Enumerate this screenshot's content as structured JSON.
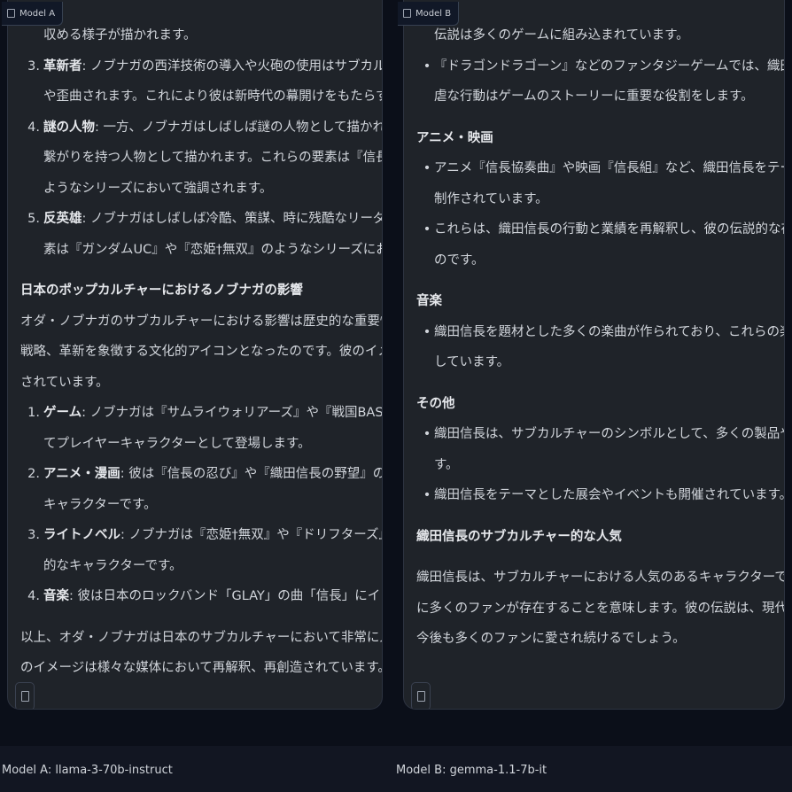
{
  "panel_a": {
    "tag": "Model A",
    "lines": [
      {
        "kind": "cont",
        "text": "収める様子が描かれます。"
      },
      {
        "kind": "num",
        "num": "3.",
        "bold": "革新者",
        "text": ": ノブナガの西洋技術の導入や火砲の使用はサブカルチャーにおいてしばしば誇張"
      },
      {
        "kind": "cont",
        "text": "や歪曲されます。これにより彼は新時代の幕開けをもたらすビジョナリーとして描かれます。"
      },
      {
        "kind": "num",
        "num": "4.",
        "bold": "謎の人物",
        "text": ": 一方、ノブナガはしばしば謎の人物として描かれ、超人的な能力や超自然的な"
      },
      {
        "kind": "cont",
        "text": "繋がりを持つ人物として描かれます。これらの要素は『信長THE FOOL』や『ドリフターズ』の"
      },
      {
        "kind": "cont",
        "text": "ようなシリーズにおいて強調されます。"
      },
      {
        "kind": "num",
        "num": "5.",
        "bold": "反英雄",
        "text": ": ノブナガはしばしば冷酷、策謀、時に残酷なリーダーとして描かれます。これらの要"
      },
      {
        "kind": "cont",
        "text": "素は『ガンダムUC』や『恋姫†無双』のようなシリーズにおいて強調されます。"
      },
      {
        "kind": "gap"
      },
      {
        "kind": "heading",
        "text": "日本のポップカルチャーにおけるノブナガの影響"
      },
      {
        "kind": "para",
        "text": "オダ・ノブナガのサブカルチャーにおける影響は歴史的な重要性を超えています。彼はパワー、"
      },
      {
        "kind": "para",
        "text": "戦略、革新を象徴する文化的アイコンとなったのです。彼のイメージは様々な媒体において使用"
      },
      {
        "kind": "para",
        "text": "されています。"
      },
      {
        "kind": "num",
        "num": "1.",
        "bold": "ゲーム",
        "text": ": ノブナガは『サムライウォリアーズ』や『戦国BASARA』のようなゲームシリーズにおい"
      },
      {
        "kind": "cont",
        "text": "てプレイヤーキャラクターとして登場します。"
      },
      {
        "kind": "num",
        "num": "2.",
        "bold": "アニメ・漫画",
        "text": ": 彼は『信長の忍び』や『織田信長の野望』のようなアニメシリーズの中心的な"
      },
      {
        "kind": "cont",
        "text": "キャラクターです。"
      },
      {
        "kind": "num",
        "num": "3.",
        "bold": "ライトノベル",
        "text": ": ノブナガは『恋姫†無双』や『ドリフターズ』のようなライトノベルシリーズの中心"
      },
      {
        "kind": "cont",
        "text": "的なキャラクターです。"
      },
      {
        "kind": "num",
        "num": "4.",
        "bold": "音楽",
        "text": ": 彼は日本のロックバンド「GLAY」の曲「信長」にインスパイアされています。"
      },
      {
        "kind": "gap"
      },
      {
        "kind": "para",
        "text": "以上、オダ・ノブナガは日本のサブカルチャーにおいて非常に人気のあるキャラクターであり、彼"
      },
      {
        "kind": "para",
        "text": "のイメージは様々な媒体において再解釈、再創造されています。"
      }
    ],
    "footer": "Model A: llama-3-70b-instruct"
  },
  "panel_b": {
    "tag": "Model B",
    "lines": [
      {
        "kind": "bulcont",
        "text": "伝説は多くのゲームに組み込まれています。"
      },
      {
        "kind": "bullet",
        "text": "『ドラゴンドラゴーン』などのファンタジーゲームでは、織田信長は悪役として出現し、彼の残"
      },
      {
        "kind": "bulcont",
        "text": "虐な行動はゲームのストーリーに重要な役割をします。"
      },
      {
        "kind": "gap"
      },
      {
        "kind": "heading",
        "text": "アニメ・映画"
      },
      {
        "kind": "bullet",
        "text": "アニメ『信長協奏曲』や映画『信長組』など、織田信長をテーマとした多くのアニメや映画が"
      },
      {
        "kind": "bulcont",
        "text": "制作されています。"
      },
      {
        "kind": "bullet",
        "text": "これらは、織田信長の行動と業績を再解釈し、彼の伝説的な存在を新しい世代に伝えるも"
      },
      {
        "kind": "bulcont",
        "text": "のです。"
      },
      {
        "kind": "gap"
      },
      {
        "kind": "heading",
        "text": "音楽"
      },
      {
        "kind": "bullet",
        "text": "織田信長を題材とした多くの楽曲が作られており、これらの楽曲は、彼の行動と業績を表現"
      },
      {
        "kind": "bulcont",
        "text": "しています。"
      },
      {
        "kind": "gap"
      },
      {
        "kind": "heading",
        "text": "その他"
      },
      {
        "kind": "bullet",
        "text": "織田信長は、サブカルチャーのシンボルとして、多くの製品やアイテムに使用されていま"
      },
      {
        "kind": "bulcont",
        "text": "す。"
      },
      {
        "kind": "bullet",
        "text": "織田信長をテーマとした展会やイベントも開催されています。"
      },
      {
        "kind": "gap"
      },
      {
        "kind": "heading",
        "text": "織田信長のサブカルチャー的な人気"
      },
      {
        "kind": "gap"
      },
      {
        "kind": "para",
        "text": "織田信長は、サブカルチャーにおける人気のあるキャラクターであり、これは、彼の行動と業績"
      },
      {
        "kind": "para",
        "text": "に多くのファンが存在することを意味します。彼の伝説は、現代のサブカルチャルの基盤となり、"
      },
      {
        "kind": "para",
        "text": "今後も多くのファンに愛され続けるでしょう。"
      }
    ],
    "footer": "Model B: gemma-1.1-7b-it"
  }
}
